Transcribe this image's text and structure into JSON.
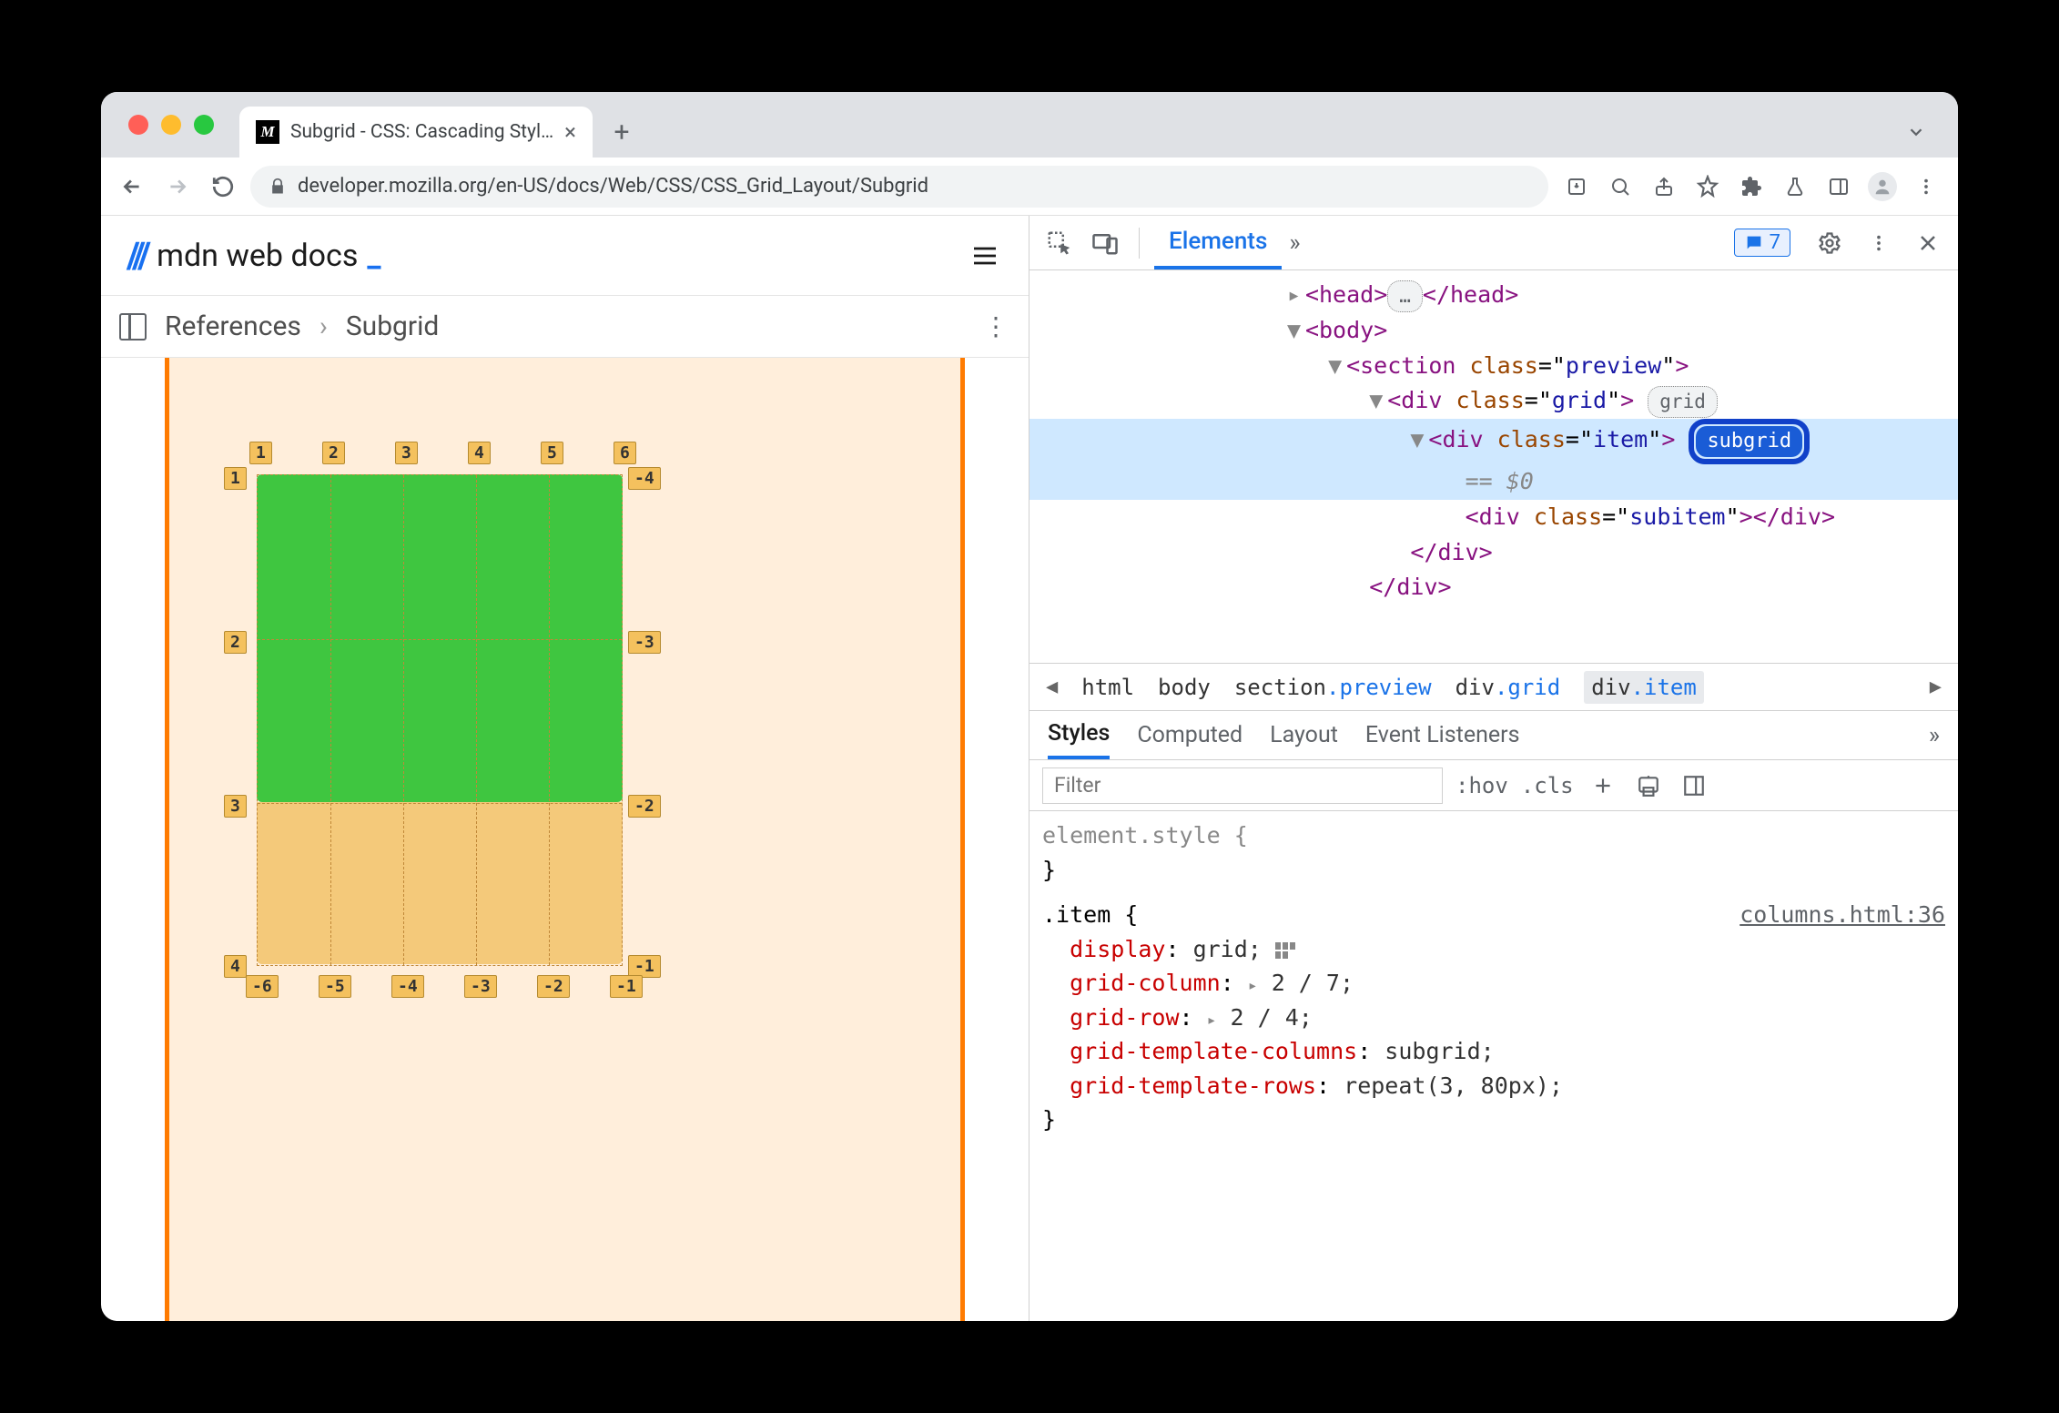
{
  "tab_title": "Subgrid - CSS: Cascading Styl…",
  "url": "developer.mozilla.org/en-US/docs/Web/CSS/CSS_Grid_Layout/Subgrid",
  "mdn_brand": "mdn web docs",
  "crumbs": {
    "ref": "References",
    "page": "Subgrid"
  },
  "grid_labels": {
    "top": [
      "1",
      "2",
      "3",
      "4",
      "5",
      "6"
    ],
    "left": [
      "1",
      "2",
      "3",
      "4"
    ],
    "right": [
      "-4",
      "-3",
      "-2",
      "-1"
    ],
    "bottom": [
      "-6",
      "-5",
      "-4",
      "-3",
      "-2",
      "-1"
    ]
  },
  "devtools": {
    "panel": "Elements",
    "issues_count": "7",
    "dom": {
      "head_open": "<head>",
      "head_ell": "…",
      "head_close": "</head>",
      "body": "<body>",
      "section": "<section class=\"preview\">",
      "grid": "<div class=\"grid\">",
      "grid_badge": "grid",
      "item": "<div class=\"item\">",
      "subgrid_badge": "subgrid",
      "eqzero": "== $0",
      "subitem": "<div class=\"subitem\"></div>",
      "div_close1": "</div>",
      "div_close2": "</div>"
    },
    "breadcrumb": [
      "html",
      "body",
      "section.preview",
      "div.grid",
      "div.item"
    ],
    "style_tabs": [
      "Styles",
      "Computed",
      "Layout",
      "Event Listeners"
    ],
    "filter_placeholder": "Filter",
    "hov": ":hov",
    "cls": ".cls",
    "element_style": "element.style {",
    "element_style_close": "}",
    "rule_selector": ".item {",
    "rule_source": "columns.html:36",
    "decls": [
      {
        "p": "display",
        "v": "grid;",
        "swatch": true
      },
      {
        "p": "grid-column",
        "v": "▸ 2 / 7;"
      },
      {
        "p": "grid-row",
        "v": "▸ 2 / 4;"
      },
      {
        "p": "grid-template-columns",
        "v": "subgrid;"
      },
      {
        "p": "grid-template-rows",
        "v": "repeat(3, 80px);"
      }
    ],
    "rule_close": "}"
  }
}
